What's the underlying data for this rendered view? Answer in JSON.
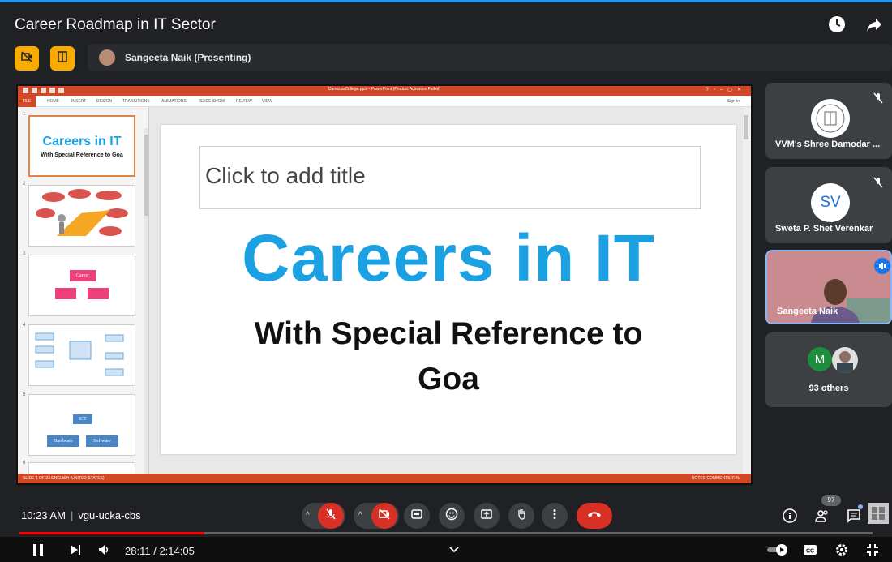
{
  "video": {
    "title": "Career Roadmap in IT Sector",
    "current_time": "28:11",
    "time_separator": "/",
    "duration": "2:14:05",
    "progress_fraction": 0.217
  },
  "meet": {
    "presenter_label": "Sangeeta Naik (Presenting)",
    "clock": "10:23 AM",
    "meeting_code": "vgu-ucka-cbs",
    "separator": "|",
    "participant_badge": "97"
  },
  "ppt": {
    "window_title": "DamodarCollege.pptx - PowerPoint (Product Activation Failed)",
    "tabs": [
      "FILE",
      "HOME",
      "INSERT",
      "DESIGN",
      "TRANSITIONS",
      "ANIMATIONS",
      "SLIDE SHOW",
      "REVIEW",
      "VIEW"
    ],
    "sign_in": "Sign in",
    "status_left": "SLIDE 1 OF 23    ENGLISH (UNITED STATES)",
    "status_right": "NOTES   COMMENTS                       71%",
    "thumb_numbers": [
      "1",
      "2",
      "3",
      "4",
      "5",
      "6"
    ],
    "thumb1_title": "Careers in IT",
    "thumb1_sub": "With Special Reference to Goa",
    "thumb3_box": "Career",
    "thumb5_top": "ICT",
    "thumb5_left": "Hardware",
    "thumb5_right": "Software"
  },
  "slide": {
    "title_placeholder": "Click to add title",
    "main_title": "Careers in IT",
    "subtitle_line1": "With Special Reference to",
    "subtitle_line2": "Goa"
  },
  "participants": [
    {
      "name": "VVM's Shree Damodar ...",
      "muted": true
    },
    {
      "name": "Sweta P. Shet Verenkar",
      "initials": "SV",
      "muted": true
    },
    {
      "name": "Sangeeta Naik",
      "speaking": true
    },
    {
      "name": "93 others",
      "initial": "M"
    }
  ],
  "colors": {
    "accent_yellow": "#f9ab00",
    "meet_red": "#d93025",
    "ppt_orange": "#d24726",
    "slide_blue": "#1ba1e2",
    "yt_red": "#ff0000"
  },
  "icons": [
    "clock-icon",
    "share-icon",
    "camera-off-icon",
    "layout-icon",
    "mic-off-icon",
    "captions-icon",
    "emoji-icon",
    "present-icon",
    "raise-hand-icon",
    "more-icon",
    "end-call-icon",
    "info-icon",
    "people-icon",
    "chat-icon",
    "activities-icon",
    "pause-icon",
    "next-icon",
    "volume-icon",
    "chevron-down-icon",
    "autoplay-toggle-icon",
    "cc-icon",
    "settings-icon",
    "fullscreen-exit-icon"
  ]
}
